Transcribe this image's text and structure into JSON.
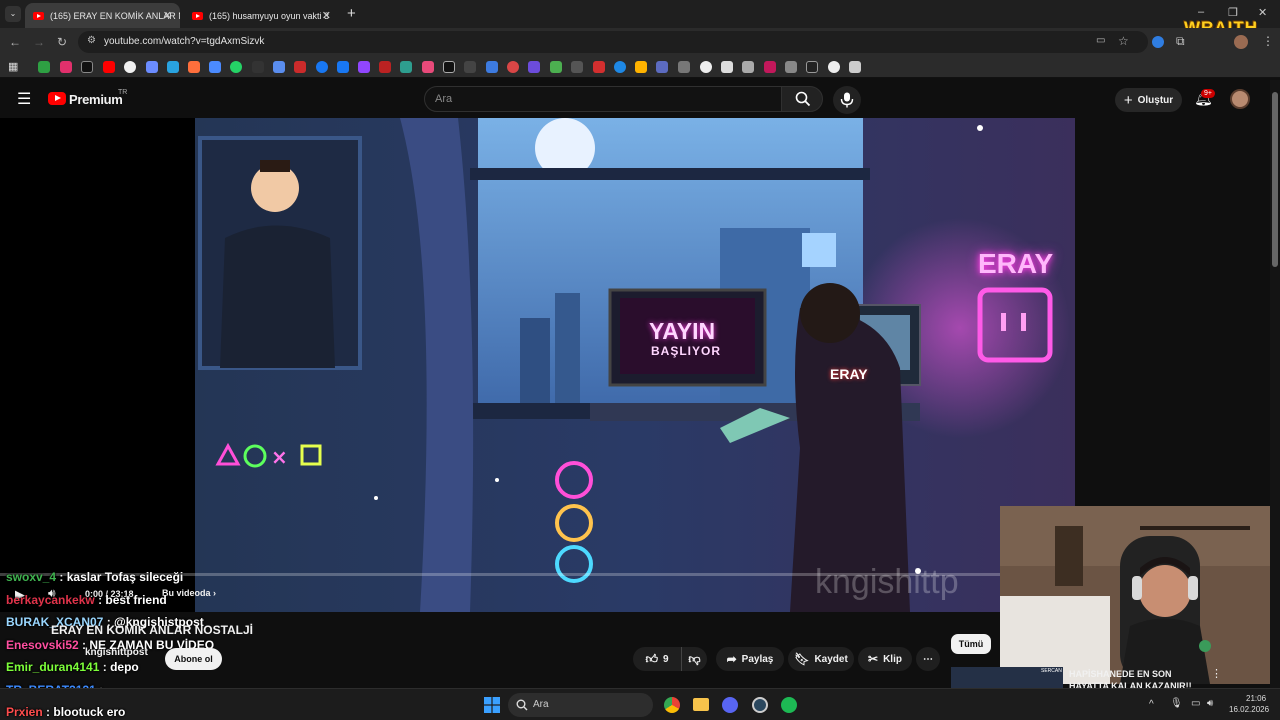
{
  "browser": {
    "tabs": [
      {
        "label": "(165) ERAY EN KOMİK ANLAR N",
        "active": true
      },
      {
        "label": "(165) husamyuyu oyun vakti 3",
        "active": false
      }
    ],
    "new_tab": "+",
    "url": "youtube.com/watch?v=tgdAxmSizvk",
    "window_controls": [
      "–",
      "❐",
      "✕"
    ]
  },
  "overlay_brand": "WRAITH",
  "youtube": {
    "logo": "Premium",
    "region": "TR",
    "search_placeholder": "Ara",
    "create_label": "Oluştur",
    "notif_badge": "9+"
  },
  "video": {
    "poster_sign_title": "ERAY",
    "screen_text_1": "YAYIN",
    "screen_text_2": "BAŞLIYOR",
    "chair_text": "ERAY",
    "watermark": "kngishittp",
    "time": "0:00 / 23:18",
    "in_video_label": "Bu videoda",
    "title": "ERAY EN KOMİK ANLAR NOSTALJİ",
    "channel": "kngishittpost",
    "subscribe": "Abone ol"
  },
  "chat": [
    {
      "user": "swoxv_4",
      "message": "kaslar Tofaş sileceği",
      "color": "#3fb34f"
    },
    {
      "user": "berkaycankekw",
      "message": "best friend",
      "color": "#e0334a"
    },
    {
      "user": "BURAK_XCAN07",
      "message": "@kngishistpost",
      "color": "#9ad7ff"
    },
    {
      "user": "Enesovski52",
      "message": "NE ZAMAN BU VİDEO",
      "color": "#ff4fa0"
    },
    {
      "user": "Emir_duran4141",
      "message": "depo",
      "color": "#7dff3a"
    },
    {
      "user": "TR_BERAT3131",
      "message": "",
      "color": "#3d8bff"
    },
    {
      "user": "Prxien",
      "message": "blootuck ero",
      "color": "#ff4d4d"
    }
  ],
  "actions": {
    "likes": "9",
    "share": "Paylaş",
    "save": "Kaydet",
    "clip": "Klip",
    "more": "⋯"
  },
  "sidebar": {
    "filter_all": "Tümü",
    "rec_title": "HAPİSHANEDE EN SON HAYATTA KALAN KAZANIR!!",
    "rec_thumb_label": "SERCAN"
  },
  "taskbar": {
    "search_placeholder": "Ara",
    "time": "21:06",
    "date": "16.02.2026"
  }
}
